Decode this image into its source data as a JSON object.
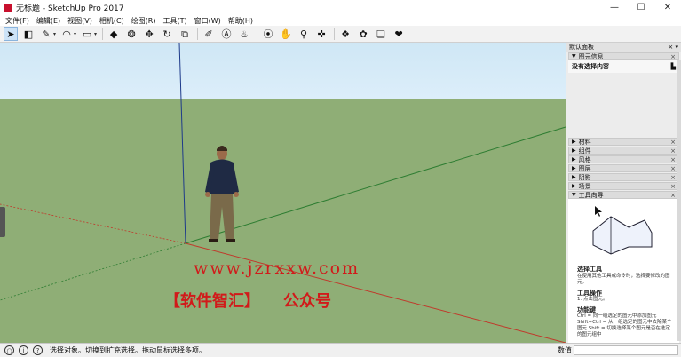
{
  "window": {
    "title": "无标题 - SketchUp Pro 2017",
    "minimize": "—",
    "maximize": "☐",
    "close": "✕"
  },
  "menu": [
    "文件(F)",
    "编辑(E)",
    "视图(V)",
    "相机(C)",
    "绘图(R)",
    "工具(T)",
    "窗口(W)",
    "帮助(H)"
  ],
  "toolbar": {
    "tools": [
      {
        "name": "select-tool-icon",
        "glyph": "➤",
        "selected": true
      },
      {
        "name": "eraser-tool-icon",
        "glyph": "◧"
      },
      {
        "name": "line-tool-icon",
        "glyph": "✎",
        "arrow": true
      },
      {
        "name": "arc-tool-icon",
        "glyph": "◠",
        "arrow": true
      },
      {
        "name": "rectangle-tool-icon",
        "glyph": "▭",
        "arrow": true
      },
      {
        "name": "push-pull-tool-icon",
        "glyph": "◆"
      },
      {
        "name": "follow-me-tool-icon",
        "glyph": "❂"
      },
      {
        "name": "move-tool-icon",
        "glyph": "✥"
      },
      {
        "name": "rotate-tool-icon",
        "glyph": "↻"
      },
      {
        "name": "scale-tool-icon",
        "glyph": "⧉"
      },
      {
        "name": "tape-measure-tool-icon",
        "glyph": "✐"
      },
      {
        "name": "text-tool-icon",
        "glyph": "Ⓐ"
      },
      {
        "name": "paint-bucket-tool-icon",
        "glyph": "♨"
      },
      {
        "name": "orbit-tool-icon",
        "glyph": "⦿"
      },
      {
        "name": "pan-tool-icon",
        "glyph": "✋"
      },
      {
        "name": "zoom-tool-icon",
        "glyph": "⚲"
      },
      {
        "name": "zoom-extents-tool-icon",
        "glyph": "✜"
      },
      {
        "name": "warehouse-icon",
        "glyph": "❖"
      },
      {
        "name": "extension-warehouse-icon",
        "glyph": "✿"
      },
      {
        "name": "send-to-layout-icon",
        "glyph": "❏"
      },
      {
        "name": "extension-manager-icon",
        "glyph": "❤"
      }
    ]
  },
  "tray": {
    "title": "默认面板",
    "pin": "× ▾",
    "entity_info": {
      "label": "图元信息",
      "content": "没有选择内容"
    },
    "panels": [
      {
        "label": "材料"
      },
      {
        "label": "组件"
      },
      {
        "label": "风格"
      },
      {
        "label": "图层"
      },
      {
        "label": "阴影"
      },
      {
        "label": "场景"
      }
    ],
    "instructor": {
      "label": "工具向导",
      "heading": "选择工具",
      "desc": "在使用其他工具或命令时，选择要修改的图元。",
      "ops_heading": "工具操作",
      "ops": "1. 点击图元。",
      "keys_heading": "功能键",
      "keys": "Ctrl = 向一组选定的图元中添加图元 Shift+Ctrl = 从一组选定的图元中去除某个图元 Shift = 切换选择某个图元是否在选定的图元组中"
    }
  },
  "watermark": {
    "url": "www.jzrxxw.com",
    "brand": "【软件智汇】",
    "suffix": "公众号"
  },
  "statusbar": {
    "hint": "选择对象。切换到扩充选择。拖动鼠标选择多项。",
    "measure_label": "数值"
  },
  "colors": {
    "sky": "#d6ebf8",
    "ground": "#8fae76",
    "axis_red": "#c0392b",
    "axis_green": "#2e7d32",
    "axis_blue": "#1e3a8a",
    "watermark": "#d11a1a"
  }
}
